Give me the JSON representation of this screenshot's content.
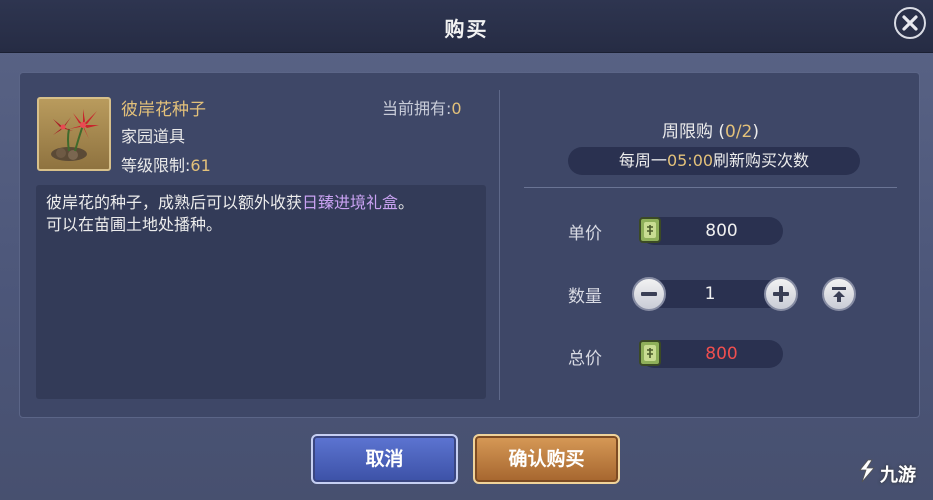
{
  "dialog": {
    "title": "购买",
    "close_icon": "close-icon"
  },
  "item": {
    "icon": "red-spider-lily-seed-icon",
    "name": "彼岸花种子",
    "type": "家园道具",
    "level_label": "等级限制:",
    "level_value": "61",
    "owned_label": "当前拥有:",
    "owned_value": "0",
    "description_part1": "彼岸花的种子，成熟后可以额外收获",
    "description_highlight": "日臻进境礼盒",
    "description_part2": "。",
    "description_line2": "可以在苗圃土地处播种。"
  },
  "purchase": {
    "limit_label": "周限购 (",
    "limit_value": "0/2",
    "limit_close": ")",
    "refresh_prefix": "每周一",
    "refresh_time": "05:00",
    "refresh_suffix": "刷新购买次数",
    "unit_price_label": "单价",
    "unit_price": "800",
    "quantity_label": "数量",
    "quantity": "1",
    "total_label": "总价",
    "total_price": "800",
    "currency_icon": "jade-token-icon",
    "minus_icon": "minus-icon",
    "plus_icon": "plus-icon",
    "max_icon": "max-quantity-icon"
  },
  "buttons": {
    "cancel": "取消",
    "confirm": "确认购买"
  },
  "watermark": {
    "text": "九游"
  },
  "colors": {
    "gold": "#e3c17a",
    "purple_highlight": "#c9a2f2",
    "total_red": "#f04f4f"
  }
}
